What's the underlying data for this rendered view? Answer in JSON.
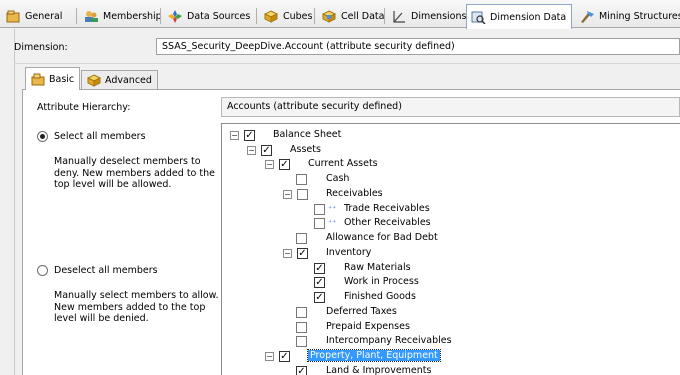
{
  "tabs": [
    {
      "label": "General",
      "icon": "general-icon"
    },
    {
      "label": "Membership",
      "icon": "membership-icon"
    },
    {
      "label": "Data Sources",
      "icon": "data-sources-icon"
    },
    {
      "label": "Cubes",
      "icon": "cube-icon"
    },
    {
      "label": "Cell Data",
      "icon": "cell-data-icon"
    },
    {
      "label": "Dimensions",
      "icon": "dimensions-icon"
    },
    {
      "label": "Dimension Data",
      "icon": "dimension-data-icon",
      "active": true
    },
    {
      "label": "Mining Structures",
      "icon": "mining-structures-icon"
    }
  ],
  "dimension": {
    "label": "Dimension:",
    "value": "SSAS_Security_DeepDive.Account (attribute security defined)"
  },
  "subtabs": [
    {
      "label": "Basic",
      "icon": "basic-icon",
      "active": true
    },
    {
      "label": "Advanced",
      "icon": "advanced-icon"
    }
  ],
  "attribute": {
    "label": "Attribute Hierarchy:",
    "value": "Accounts (attribute security defined)"
  },
  "options": {
    "select_all": {
      "label": "Select all members",
      "selected": true,
      "description": [
        "Manually deselect members to",
        "deny. New members added to the",
        "top level will be allowed."
      ]
    },
    "deselect_all": {
      "label": "Deselect all members",
      "selected": false,
      "description": [
        "Manually select members to allow.",
        "New members added to the top",
        "level will be denied."
      ]
    }
  },
  "tree": [
    {
      "label": "Balance Sheet",
      "expander": "minus",
      "checked": true
    },
    {
      "label": "Assets",
      "expander": "minus",
      "checked": true
    },
    {
      "label": "Current Assets",
      "expander": "minus",
      "checked": true
    },
    {
      "label": "Cash",
      "checked": false
    },
    {
      "label": "Receivables",
      "expander": "minus",
      "checked": false
    },
    {
      "label": "Trade Receivables",
      "checked": false,
      "icon": "member-icon"
    },
    {
      "label": "Other Receivables",
      "checked": false,
      "icon": "member-icon"
    },
    {
      "label": "Allowance for Bad Debt",
      "checked": false
    },
    {
      "label": "Inventory",
      "expander": "minus",
      "checked": true
    },
    {
      "label": "Raw Materials",
      "checked": true
    },
    {
      "label": "Work in Process",
      "checked": true
    },
    {
      "label": "Finished Goods",
      "checked": true
    },
    {
      "label": "Deferred Taxes",
      "checked": false
    },
    {
      "label": "Prepaid Expenses",
      "checked": false
    },
    {
      "label": "Intercompany Receivables",
      "checked": false
    },
    {
      "label": "Property, Plant, Equipment",
      "expander": "minus",
      "checked": true,
      "selected": true
    },
    {
      "label": "Land & Improvements",
      "checked": true
    }
  ],
  "colors": {
    "selection": "#3399ff",
    "active_tab_border": "#8fa7c8"
  }
}
